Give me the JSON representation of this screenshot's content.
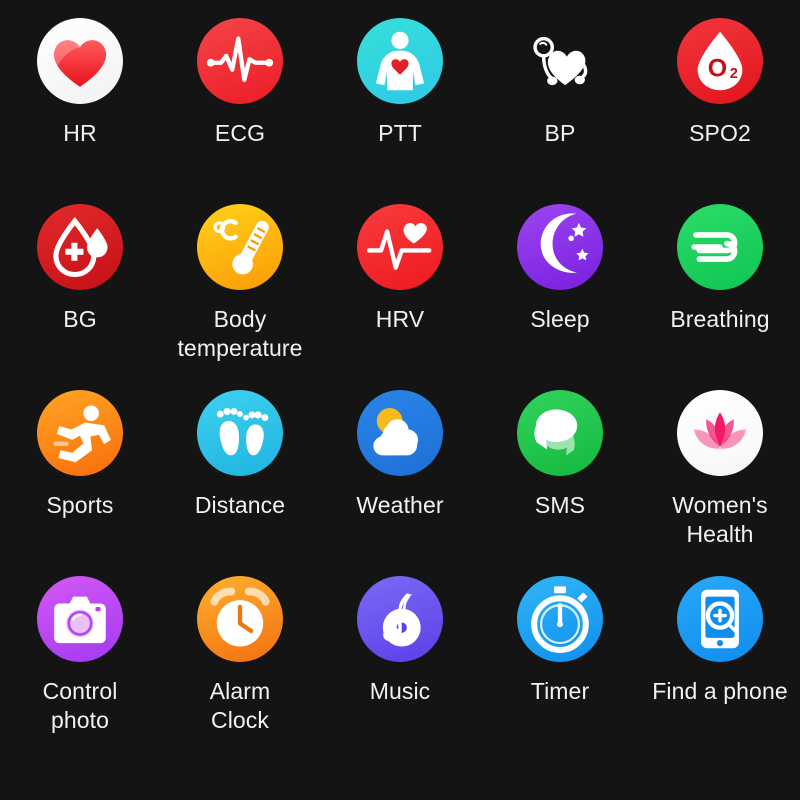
{
  "screen": {
    "background_color": "#141414",
    "label_color": "#f2f2f2",
    "columns": 5,
    "rows": 4,
    "total_items": 20
  },
  "items": [
    {
      "label": "HR",
      "icon": "heart-icon",
      "circle_from": "#ffffff",
      "circle_to": "#f2f2f2",
      "accent": "#f0242a"
    },
    {
      "label": "ECG",
      "icon": "ecg-waveform-icon",
      "circle_from": "#f4454a",
      "circle_to": "#ec1c26",
      "accent": "#ffffff"
    },
    {
      "label": "PTT",
      "icon": "body-torso-icon",
      "circle_from": "#35e0d8",
      "circle_to": "#2fc8e8",
      "accent": "#ffffff"
    },
    {
      "label": "BP",
      "icon": "blood-pressure-cuff-icon",
      "circle_from": "#f7b game",
      "circle_to": "#f97a14",
      "accent": "#ffffff"
    },
    {
      "label": "SPO2",
      "icon": "oxygen-drop-icon",
      "circle_from": "#f3353c",
      "circle_to": "#e0151c",
      "accent": "#ffffff"
    },
    {
      "label": "BG",
      "icon": "blood-glucose-drop-icon",
      "circle_from": "#e22a2a",
      "circle_to": "#c41017",
      "accent": "#ffffff"
    },
    {
      "label": "Body\ntemperature",
      "icon": "thermometer-icon",
      "circle_from": "#ffd21a",
      "circle_to": "#fb9a06",
      "accent": "#ffffff"
    },
    {
      "label": "HRV",
      "icon": "hrv-heart-wave-icon",
      "circle_from": "#f93c3c",
      "circle_to": "#ed1a20",
      "accent": "#ffffff"
    },
    {
      "label": "Sleep",
      "icon": "moon-stars-icon",
      "circle_from": "#9b46f0",
      "circle_to": "#7a1fe0",
      "accent": "#ffffff"
    },
    {
      "label": "Breathing",
      "icon": "breathing-wind-icon",
      "circle_from": "#2bdc6a",
      "circle_to": "#10c553",
      "accent": "#ffffff"
    },
    {
      "label": "Sports",
      "icon": "running-person-icon",
      "circle_from": "#ffa524",
      "circle_to": "#f96d0b",
      "accent": "#ffffff"
    },
    {
      "label": "Distance",
      "icon": "footprints-icon",
      "circle_from": "#3fd1f0",
      "circle_to": "#1fb3e0",
      "accent": "#ffffff"
    },
    {
      "label": "Weather",
      "icon": "sun-cloud-icon",
      "circle_from": "#2a85e8",
      "circle_to": "#1f6fd6",
      "accent": "#ffffff"
    },
    {
      "label": "SMS",
      "icon": "chat-bubbles-icon",
      "circle_from": "#31d35c",
      "circle_to": "#15b93f",
      "accent": "#ffffff"
    },
    {
      "label": "Women's\nHealth",
      "icon": "lotus-flower-icon",
      "circle_from": "#ffffff",
      "circle_to": "#f7f7f7",
      "accent": "#f2186a"
    },
    {
      "label": "Control\nphoto",
      "icon": "camera-icon",
      "circle_from": "#d457f5",
      "circle_to": "#a23bf0",
      "accent": "#ffffff"
    },
    {
      "label": "Alarm\nClock",
      "icon": "alarm-clock-icon",
      "circle_from": "#ffb02e",
      "circle_to": "#f2700f",
      "accent": "#ffffff"
    },
    {
      "label": "Music",
      "icon": "music-note-disc-icon",
      "circle_from": "#7b6bf5",
      "circle_to": "#5b3fe8",
      "accent": "#ffffff"
    },
    {
      "label": "Timer",
      "icon": "stopwatch-icon",
      "circle_from": "#31b6f5",
      "circle_to": "#0f8fee",
      "accent": "#ffffff"
    },
    {
      "label": "Find a phone",
      "icon": "find-phone-icon",
      "circle_from": "#2aa8f7",
      "circle_to": "#0f8def",
      "accent": "#ffffff"
    }
  ]
}
